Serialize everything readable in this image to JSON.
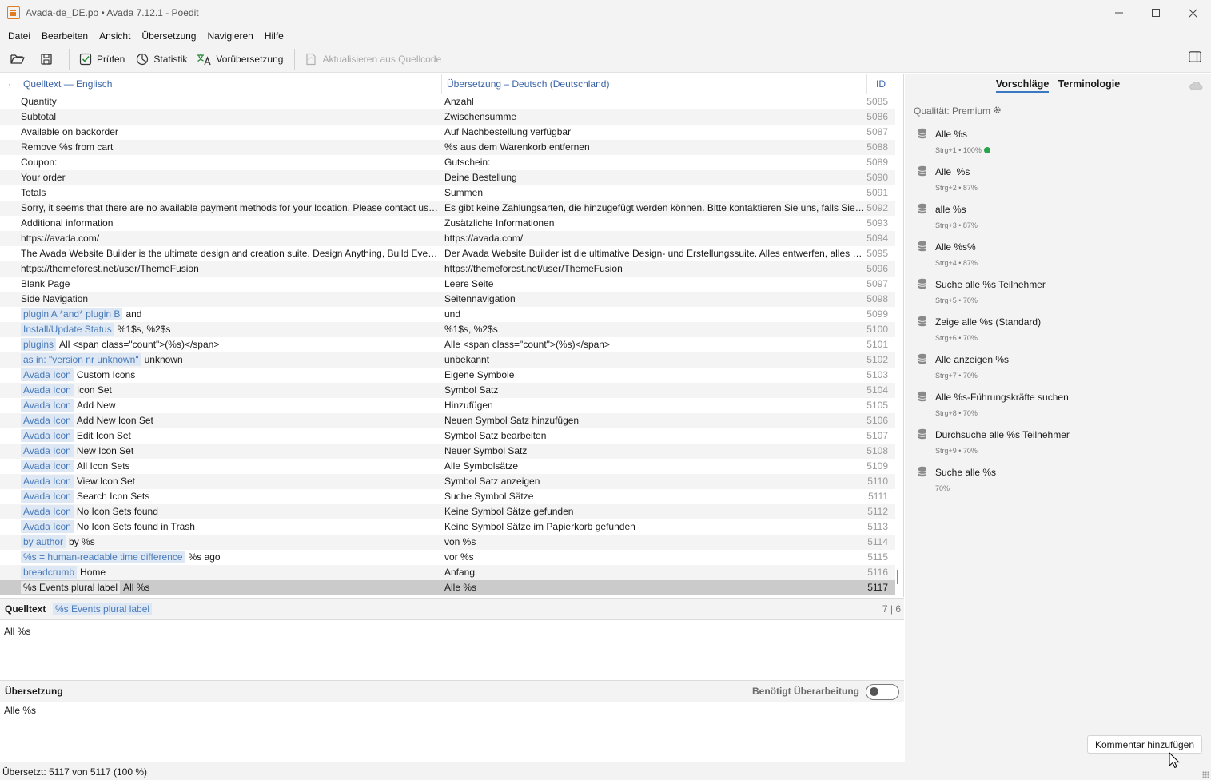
{
  "window": {
    "title": "Avada-de_DE.po • Avada 7.12.1 - Poedit"
  },
  "menu": [
    "Datei",
    "Bearbeiten",
    "Ansicht",
    "Übersetzung",
    "Navigieren",
    "Hilfe"
  ],
  "toolbar": {
    "validate_label": "Prüfen",
    "stats_label": "Statistik",
    "pretranslate_label": "Vorübersetzung",
    "update_label": "Aktualisieren aus Quellcode"
  },
  "list": {
    "header_dot": "·",
    "header_source": "Quelltext — Englisch",
    "header_translation": "Übersetzung – Deutsch (Deutschland)",
    "header_id": "ID",
    "rows": [
      {
        "ctx": "",
        "src": "Quantity",
        "tr": "Anzahl",
        "id": "5085"
      },
      {
        "ctx": "",
        "src": "Subtotal",
        "tr": "Zwischensumme",
        "id": "5086"
      },
      {
        "ctx": "",
        "src": "Available on backorder",
        "tr": "Auf Nachbestellung verfügbar",
        "id": "5087"
      },
      {
        "ctx": "",
        "src": "Remove %s from cart",
        "tr": "%s aus dem Warenkorb entfernen",
        "id": "5088"
      },
      {
        "ctx": "",
        "src": "Coupon:",
        "tr": "Gutschein:",
        "id": "5089"
      },
      {
        "ctx": "",
        "src": "Your order",
        "tr": "Deine Bestellung",
        "id": "5090"
      },
      {
        "ctx": "",
        "src": "Totals",
        "tr": "Summen",
        "id": "5091"
      },
      {
        "ctx": "",
        "src": "Sorry, it seems that there are no available payment methods for your location. Please contact us if...",
        "tr": "Es gibt keine Zahlungsarten, die hinzugefügt werden können. Bitte kontaktieren Sie uns, falls Sie H...",
        "id": "5092"
      },
      {
        "ctx": "",
        "src": "Additional information",
        "tr": "Zusätzliche Informationen",
        "id": "5093"
      },
      {
        "ctx": "",
        "src": "https://avada.com/",
        "tr": "https://avada.com/",
        "id": "5094"
      },
      {
        "ctx": "",
        "src": "The Avada Website Builder is the ultimate design and creation suite. Design Anything, Build Every...",
        "tr": "Der Avada Website Builder ist die ultimative Design- und Erstellungssuite. Alles entwerfen, alles ba...",
        "id": "5095"
      },
      {
        "ctx": "",
        "src": "https://themeforest.net/user/ThemeFusion",
        "tr": "https://themeforest.net/user/ThemeFusion",
        "id": "5096"
      },
      {
        "ctx": "",
        "src": "Blank Page",
        "tr": "Leere Seite",
        "id": "5097"
      },
      {
        "ctx": "",
        "src": "Side Navigation",
        "tr": "Seitennavigation",
        "id": "5098"
      },
      {
        "ctx": "plugin A *and* plugin B",
        "src": "and",
        "tr": "und",
        "id": "5099"
      },
      {
        "ctx": "Install/Update Status",
        "src": "%1$s, %2$s",
        "tr": "%1$s, %2$s",
        "id": "5100"
      },
      {
        "ctx": "plugins",
        "src": "All <span class=\"count\">(%s)</span>",
        "tr": "Alle <span class=\"count\">(%s)</span>",
        "id": "5101"
      },
      {
        "ctx": "as in: \"version nr unknown\"",
        "src": "unknown",
        "tr": "unbekannt",
        "id": "5102"
      },
      {
        "ctx": "Avada Icon",
        "src": "Custom Icons",
        "tr": "Eigene Symbole",
        "id": "5103"
      },
      {
        "ctx": "Avada Icon",
        "src": "Icon Set",
        "tr": "Symbol Satz",
        "id": "5104"
      },
      {
        "ctx": "Avada Icon",
        "src": "Add New",
        "tr": "Hinzufügen",
        "id": "5105"
      },
      {
        "ctx": "Avada Icon",
        "src": "Add New Icon Set",
        "tr": "Neuen Symbol Satz hinzufügen",
        "id": "5106"
      },
      {
        "ctx": "Avada Icon",
        "src": "Edit Icon Set",
        "tr": "Symbol Satz bearbeiten",
        "id": "5107"
      },
      {
        "ctx": "Avada Icon",
        "src": "New Icon Set",
        "tr": "Neuer Symbol Satz",
        "id": "5108"
      },
      {
        "ctx": "Avada Icon",
        "src": "All Icon Sets",
        "tr": "Alle Symbolsätze",
        "id": "5109"
      },
      {
        "ctx": "Avada Icon",
        "src": "View Icon Set",
        "tr": "Symbol Satz anzeigen",
        "id": "5110"
      },
      {
        "ctx": "Avada Icon",
        "src": "Search Icon Sets",
        "tr": "Suche Symbol Sätze",
        "id": "5111"
      },
      {
        "ctx": "Avada Icon",
        "src": "No Icon Sets found",
        "tr": "Keine Symbol Sätze gefunden",
        "id": "5112"
      },
      {
        "ctx": "Avada Icon",
        "src": "No Icon Sets found in Trash",
        "tr": "Keine Symbol Sätze im Papierkorb gefunden",
        "id": "5113"
      },
      {
        "ctx": "by author",
        "src": "by %s",
        "tr": "von %s",
        "id": "5114"
      },
      {
        "ctx": "%s = human-readable time difference",
        "src": "%s ago",
        "tr": "vor %s",
        "id": "5115"
      },
      {
        "ctx": "breadcrumb",
        "src": "Home",
        "tr": "Anfang",
        "id": "5116"
      },
      {
        "ctx": "%s Events plural label",
        "src": "All %s",
        "tr": "Alle %s",
        "id": "5117",
        "selected": true
      }
    ]
  },
  "source_editor": {
    "label": "Quelltext",
    "context": "%s Events plural label",
    "count": "7 | 6",
    "text": "All %s"
  },
  "translation_editor": {
    "label": "Übersetzung",
    "needs_work_label": "Benötigt Überarbeitung",
    "text": "Alle %s"
  },
  "status": {
    "text": "Übersetzt: 5117 von 5117 (100 %)"
  },
  "sidebar": {
    "tab_suggestions": "Vorschläge",
    "tab_terminology": "Terminologie",
    "quality": "Qualität: Premium",
    "suggestions": [
      {
        "text": "Alle %s",
        "meta": "Strg+1 • 100%",
        "exact": true
      },
      {
        "text": "Alle  %s",
        "meta": "Strg+2 • 87%"
      },
      {
        "text": "alle %s",
        "meta": "Strg+3 • 87%"
      },
      {
        "text": "Alle %s%",
        "meta": "Strg+4 • 87%"
      },
      {
        "text": "Suche alle %s Teilnehmer",
        "meta": "Strg+5 • 70%"
      },
      {
        "text": "Zeige alle %s (Standard)",
        "meta": "Strg+6 • 70%"
      },
      {
        "text": "Alle anzeigen %s",
        "meta": "Strg+7 • 70%"
      },
      {
        "text": "Alle %s-Führungskräfte suchen",
        "meta": "Strg+8 • 70%"
      },
      {
        "text": "Durchsuche alle %s Teilnehmer",
        "meta": "Strg+9 • 70%"
      },
      {
        "text": "Suche alle %s",
        "meta": "70%"
      }
    ],
    "add_comment_label": "Kommentar hinzufügen"
  },
  "colors": {
    "accent": "#3a78c2",
    "context_bg": "#dde8f4",
    "context_text": "#4a7ab8",
    "selected_row": "#cbcbcb"
  }
}
